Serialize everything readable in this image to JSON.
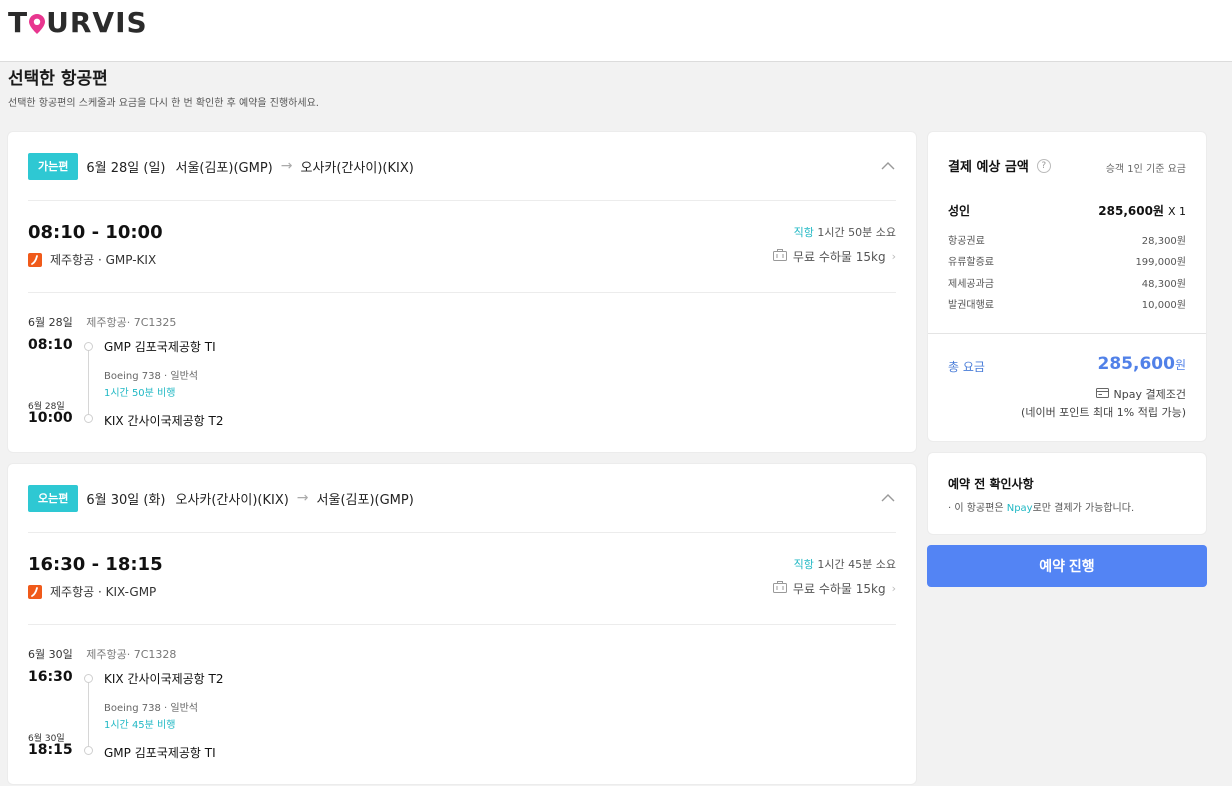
{
  "header": {
    "logo_text_left": "T",
    "logo_text_right": "URVIS",
    "logo_pin_color": "#e8368f"
  },
  "page": {
    "title": "선택한 항공편",
    "subtitle": "선택한 항공편의 스케줄과 요금을 다시 한 번 확인한 후 예약을 진행하세요."
  },
  "flights": [
    {
      "badge": "가는편",
      "date": "6월 28일 (일)",
      "from": "서울(김포)(GMP)",
      "arrow": "→",
      "to": "오사카(간사이)(KIX)",
      "times": "08:10 - 10:00",
      "direct_label": "직항",
      "duration_label": "1시간 50분 소요",
      "airline_route": "제주항공 · GMP-KIX",
      "baggage": "무료 수하물 15kg",
      "segment": {
        "date": "6월 28일",
        "flight_no": "제주항공· 7C1325",
        "dep_time": "08:10",
        "dep_airport": "GMP 김포국제공항 TI",
        "aircraft": "Boeing 738 · 일반석",
        "duration": "1시간 50분 비행",
        "arr_date": "6월 28일",
        "arr_time": "10:00",
        "arr_airport": "KIX 간사이국제공항 T2"
      }
    },
    {
      "badge": "오는편",
      "date": "6월 30일 (화)",
      "from": "오사카(간사이)(KIX)",
      "arrow": "→",
      "to": "서울(김포)(GMP)",
      "times": "16:30 - 18:15",
      "direct_label": "직항",
      "duration_label": "1시간 45분 소요",
      "airline_route": "제주항공 · KIX-GMP",
      "baggage": "무료 수하물 15kg",
      "segment": {
        "date": "6월 30일",
        "flight_no": "제주항공· 7C1328",
        "dep_time": "16:30",
        "dep_airport": "KIX 간사이국제공항 T2",
        "aircraft": "Boeing 738 · 일반석",
        "duration": "1시간 45분 비행",
        "arr_date": "6월 30일",
        "arr_time": "18:15",
        "arr_airport": "GMP 김포국제공항 TI"
      }
    }
  ],
  "price": {
    "title": "결제 예상 금액",
    "help": "?",
    "basis": "승객 1인 기준 요금",
    "adult_label": "성인",
    "adult_value": "285,600원",
    "adult_mult": "X 1",
    "lines": [
      {
        "label": "항공권료",
        "value": "28,300원"
      },
      {
        "label": "유류할증료",
        "value": "199,000원"
      },
      {
        "label": "제세공과금",
        "value": "48,300원"
      },
      {
        "label": "발권대행료",
        "value": "10,000원"
      }
    ],
    "total_label": "총 요금",
    "total_value": "285,600",
    "total_unit": "원",
    "npay_label": "Npay 결제조건",
    "npay_note": "(네이버 포인트 최대 1% 적립 가능)"
  },
  "notice": {
    "title": "예약 전 확인사항",
    "text_before": "· 이 항공편은 ",
    "text_npay": "Npay",
    "text_after": "로만 결제가 가능합니다."
  },
  "book_button": "예약 진행",
  "colors": {
    "accent_teal": "#2ec8d3",
    "primary_blue": "#5384f4",
    "airline_orange": "#f05a1a"
  }
}
